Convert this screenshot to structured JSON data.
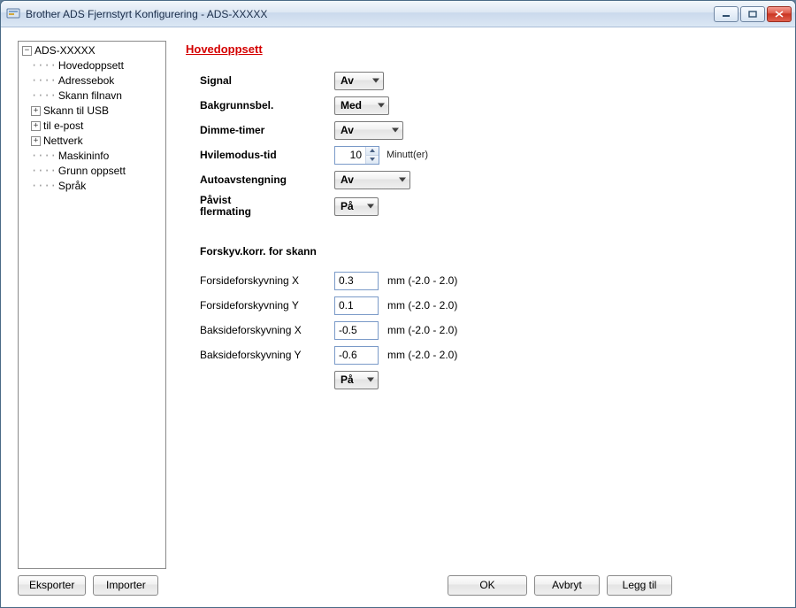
{
  "window": {
    "title": "Brother ADS Fjernstyrt Konfigurering - ADS-XXXXX"
  },
  "tree": {
    "root": "ADS-XXXXX",
    "items": [
      {
        "label": "Hovedoppsett",
        "expandable": false
      },
      {
        "label": "Adressebok",
        "expandable": false
      },
      {
        "label": "Skann filnavn",
        "expandable": false
      },
      {
        "label": "Skann til USB",
        "expandable": true
      },
      {
        "label": "til e-post",
        "expandable": true
      },
      {
        "label": "Nettverk",
        "expandable": true
      },
      {
        "label": "Maskininfo",
        "expandable": false
      },
      {
        "label": "Grunn oppsett",
        "expandable": false
      },
      {
        "label": "Språk",
        "expandable": false
      }
    ]
  },
  "page": {
    "title": "Hovedoppsett",
    "signal": {
      "label": "Signal",
      "value": "Av"
    },
    "backlight": {
      "label": "Bakgrunnsbel.",
      "value": "Med"
    },
    "dimtimer": {
      "label": "Dimme-timer",
      "value": "Av"
    },
    "sleep": {
      "label": "Hvilemodus-tid",
      "value": "10",
      "unit": "Minutt(er)"
    },
    "autooff": {
      "label": "Autoavstengning",
      "value": "Av"
    },
    "multifeed": {
      "label": "Påvist\nflermating",
      "value": "På"
    },
    "offsetSection": "Forskyv.korr. for skann",
    "frontX": {
      "label": "Forsideforskyvning X",
      "value": "0.3",
      "hint": "mm (-2.0 - 2.0)"
    },
    "frontY": {
      "label": "Forsideforskyvning Y",
      "value": "0.1",
      "hint": "mm (-2.0 - 2.0)"
    },
    "backX": {
      "label": "Baksideforskyvning X",
      "value": "-0.5",
      "hint": "mm (-2.0 - 2.0)"
    },
    "backY": {
      "label": "Baksideforskyvning Y",
      "value": "-0.6",
      "hint": "mm (-2.0 - 2.0)"
    },
    "offsetEnable": {
      "value": "På"
    }
  },
  "buttons": {
    "export": "Eksporter",
    "import": "Importer",
    "ok": "OK",
    "cancel": "Avbryt",
    "add": "Legg til"
  }
}
